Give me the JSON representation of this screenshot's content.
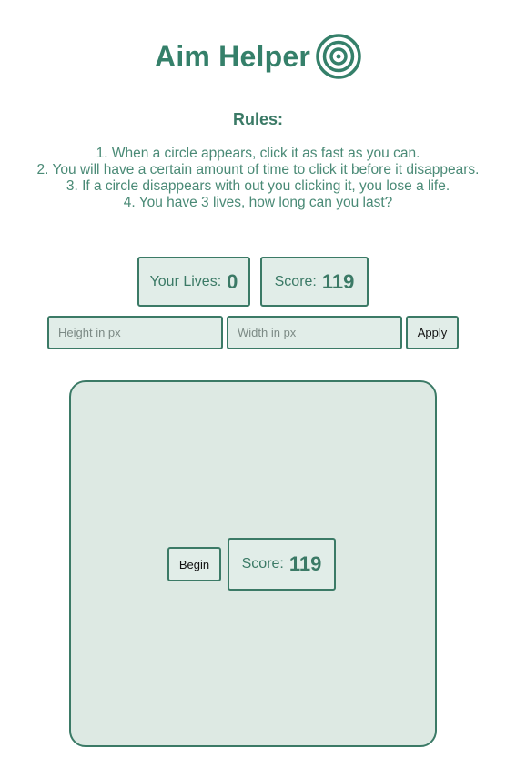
{
  "header": {
    "title": "Aim Helper",
    "icon": "target-icon",
    "accent_color": "#35806a"
  },
  "rules": {
    "heading": "Rules:",
    "items": [
      "1. When a circle appears, click it as fast as you can.",
      "2. You will have a certain amount of time to click it before it disappears.",
      "3. If a circle disappears with out you clicking it, you lose a life.",
      "4. You have 3 lives, how long can you last?"
    ]
  },
  "stats": {
    "lives_label": "Your Lives:",
    "lives_value": "0",
    "score_label": "Score:",
    "score_value": "119"
  },
  "size_controls": {
    "height_placeholder": "Height in px",
    "width_placeholder": "Width in px",
    "height_value": "",
    "width_value": "",
    "apply_label": "Apply"
  },
  "play_area": {
    "begin_label": "Begin",
    "score_label": "Score:",
    "score_value": "119"
  },
  "colors": {
    "accent": "#3b7a66",
    "panel_bg": "#e1ede8",
    "play_area_bg": "#dde9e3"
  }
}
